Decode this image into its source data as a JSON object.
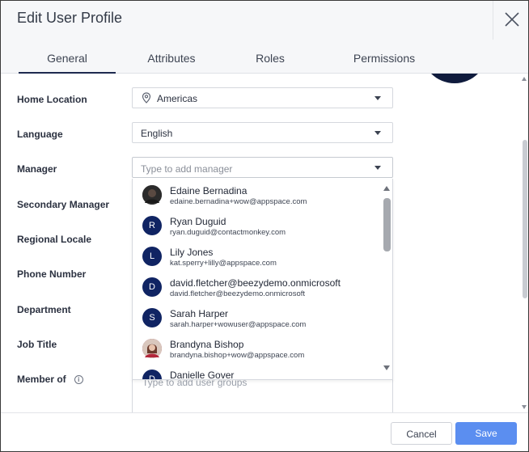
{
  "header": {
    "title": "Edit User Profile"
  },
  "tabs": [
    {
      "label": "General",
      "active": true
    },
    {
      "label": "Attributes",
      "active": false
    },
    {
      "label": "Roles",
      "active": false
    },
    {
      "label": "Permissions",
      "active": false
    }
  ],
  "form": {
    "home_location": {
      "label": "Home Location",
      "value": "Americas",
      "icon": "location-pin-icon"
    },
    "language": {
      "label": "Language",
      "value": "English"
    },
    "manager": {
      "label": "Manager",
      "placeholder": "Type to add manager"
    },
    "secondary_manager": {
      "label": "Secondary Manager"
    },
    "regional_locale": {
      "label": "Regional Locale"
    },
    "phone_number": {
      "label": "Phone Number"
    },
    "department": {
      "label": "Department"
    },
    "job_title": {
      "label": "Job Title"
    },
    "member_of": {
      "label": "Member of",
      "placeholder": "Type to add user groups",
      "info_icon": "i"
    }
  },
  "manager_dropdown": {
    "items": [
      {
        "initial": "",
        "avatar": "photo",
        "name": "Edaine Bernadina",
        "email": "edaine.bernadina+wow@appspace.com"
      },
      {
        "initial": "R",
        "avatar": "initial",
        "name": "Ryan Duguid",
        "email": "ryan.duguid@contactmonkey.com"
      },
      {
        "initial": "L",
        "avatar": "initial",
        "name": "Lily Jones",
        "email": "kat.sperry+lilly@appspace.com"
      },
      {
        "initial": "D",
        "avatar": "initial",
        "name": "david.fletcher@beezydemo.onmicrosoft",
        "email": "david.fletcher@beezydemo.onmicrosoft"
      },
      {
        "initial": "S",
        "avatar": "initial",
        "name": "Sarah Harper",
        "email": "sarah.harper+wowuser@appspace.com"
      },
      {
        "initial": "",
        "avatar": "photo",
        "name": "Brandyna Bishop",
        "email": "brandyna.bishop+wow@appspace.com"
      },
      {
        "initial": "D",
        "avatar": "initial",
        "name": "Danielle Gover",
        "email": ""
      }
    ]
  },
  "footer": {
    "cancel_label": "Cancel",
    "save_label": "Save"
  },
  "colors": {
    "primary": "#5b8ef0",
    "avatar_navy": "#102463",
    "tab_underline": "#1e2a4f"
  }
}
